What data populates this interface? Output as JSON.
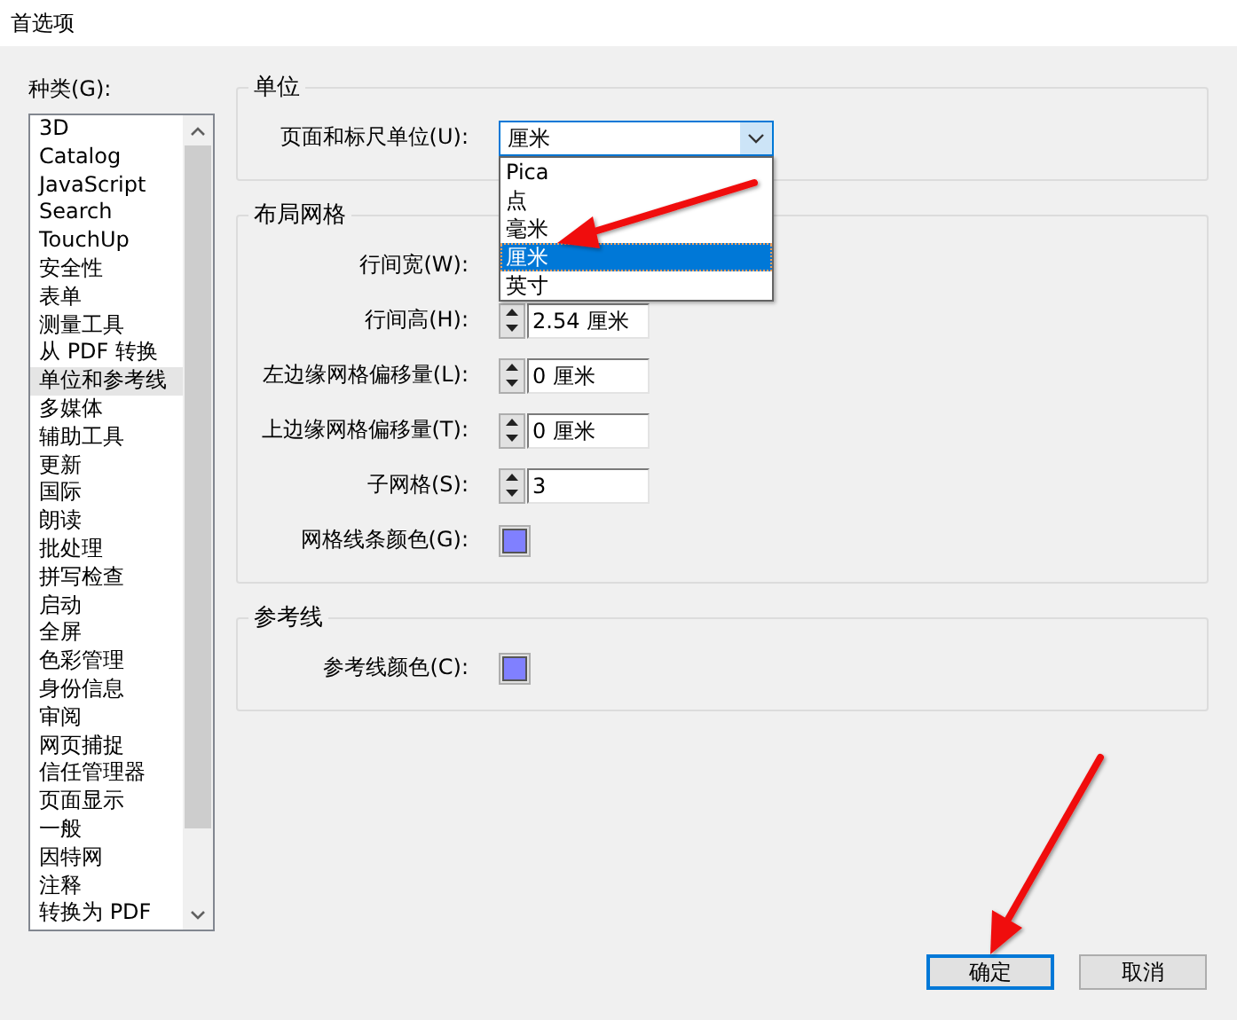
{
  "window": {
    "title": "首选项"
  },
  "categories": {
    "label": "种类(G):",
    "items": [
      {
        "label": "3D",
        "selected": false
      },
      {
        "label": "Catalog",
        "selected": false
      },
      {
        "label": "JavaScript",
        "selected": false
      },
      {
        "label": "Search",
        "selected": false
      },
      {
        "label": "TouchUp",
        "selected": false
      },
      {
        "label": "安全性",
        "selected": false
      },
      {
        "label": "表单",
        "selected": false
      },
      {
        "label": "测量工具",
        "selected": false
      },
      {
        "label": "从 PDF 转换",
        "selected": false
      },
      {
        "label": "单位和参考线",
        "selected": true
      },
      {
        "label": "多媒体",
        "selected": false
      },
      {
        "label": "辅助工具",
        "selected": false
      },
      {
        "label": "更新",
        "selected": false
      },
      {
        "label": "国际",
        "selected": false
      },
      {
        "label": "朗读",
        "selected": false
      },
      {
        "label": "批处理",
        "selected": false
      },
      {
        "label": "拼写检查",
        "selected": false
      },
      {
        "label": "启动",
        "selected": false
      },
      {
        "label": "全屏",
        "selected": false
      },
      {
        "label": "色彩管理",
        "selected": false
      },
      {
        "label": "身份信息",
        "selected": false
      },
      {
        "label": "审阅",
        "selected": false
      },
      {
        "label": "网页捕捉",
        "selected": false
      },
      {
        "label": "信任管理器",
        "selected": false
      },
      {
        "label": "页面显示",
        "selected": false
      },
      {
        "label": "一般",
        "selected": false
      },
      {
        "label": "因特网",
        "selected": false
      },
      {
        "label": "注释",
        "selected": false
      },
      {
        "label": "转换为 PDF",
        "selected": false
      }
    ]
  },
  "units": {
    "title": "单位",
    "label": "页面和标尺单位(U):",
    "value": "厘米",
    "expanded": true,
    "options": [
      {
        "label": "Pica",
        "selected": false
      },
      {
        "label": "点",
        "selected": false
      },
      {
        "label": "毫米",
        "selected": false
      },
      {
        "label": "厘米",
        "selected": true
      },
      {
        "label": "英寸",
        "selected": false
      }
    ]
  },
  "layout_grid": {
    "title": "布局网格",
    "rows": [
      {
        "kind": "spin",
        "label": "行间宽(W):"
      },
      {
        "kind": "spin",
        "label": "行间高(H):",
        "value": "2.54 厘米"
      },
      {
        "kind": "spin",
        "label": "左边缘网格偏移量(L):",
        "value": "0 厘米"
      },
      {
        "kind": "spin",
        "label": "上边缘网格偏移量(T):",
        "value": "0 厘米"
      },
      {
        "kind": "spin",
        "label": "子网格(S):",
        "value": "3"
      },
      {
        "kind": "color",
        "label": "网格线条颜色(G):",
        "color": "#8080ff"
      }
    ]
  },
  "guides": {
    "title": "参考线",
    "rows": [
      {
        "kind": "color",
        "label": "参考线颜色(C):",
        "color": "#8080ff"
      }
    ]
  },
  "buttons": [
    {
      "label": "确定",
      "focused": true
    },
    {
      "label": "取消",
      "focused": false
    }
  ]
}
